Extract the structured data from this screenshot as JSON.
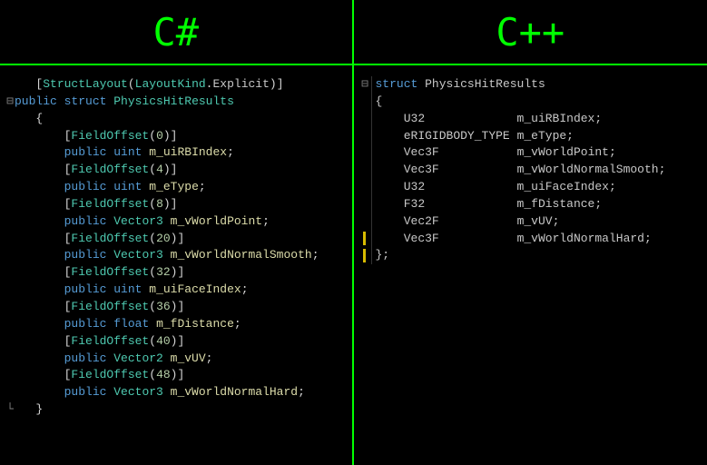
{
  "left": {
    "title": "C#",
    "attr_open": "[",
    "attr_close": "]",
    "struct_layout": "StructLayout",
    "layout_kind": "LayoutKind",
    "explicit": "Explicit",
    "public": "public",
    "struct": "struct",
    "struct_name": "PhysicsHitResults",
    "brace_open": "{",
    "brace_close": "}",
    "field_offset": "FieldOffset",
    "fields": [
      {
        "offset": "0",
        "type": "uint",
        "typecolor": "kw",
        "name": "m_uiRBIndex"
      },
      {
        "offset": "4",
        "type": "uint",
        "typecolor": "kw",
        "name": "m_eType"
      },
      {
        "offset": "8",
        "type": "Vector3",
        "typecolor": "ty",
        "name": "m_vWorldPoint"
      },
      {
        "offset": "20",
        "type": "Vector3",
        "typecolor": "ty",
        "name": "m_vWorldNormalSmooth"
      },
      {
        "offset": "32",
        "type": "uint",
        "typecolor": "kw",
        "name": "m_uiFaceIndex"
      },
      {
        "offset": "36",
        "type": "float",
        "typecolor": "kw",
        "name": "m_fDistance"
      },
      {
        "offset": "40",
        "type": "Vector2",
        "typecolor": "ty",
        "name": "m_vUV"
      },
      {
        "offset": "48",
        "type": "Vector3",
        "typecolor": "ty",
        "name": "m_vWorldNormalHard"
      }
    ]
  },
  "right": {
    "title": "C++",
    "struct_kw": "struct",
    "struct_name": "PhysicsHitResults",
    "brace_open": "{",
    "brace_close": "};",
    "fields": [
      {
        "type": "U32",
        "pad": "             ",
        "name": "m_uiRBIndex"
      },
      {
        "type": "eRIGIDBODY_TYPE",
        "pad": " ",
        "name": "m_eType"
      },
      {
        "type": "Vec3F",
        "pad": "           ",
        "name": "m_vWorldPoint"
      },
      {
        "type": "Vec3F",
        "pad": "           ",
        "name": "m_vWorldNormalSmooth"
      },
      {
        "type": "U32",
        "pad": "             ",
        "name": "m_uiFaceIndex"
      },
      {
        "type": "F32",
        "pad": "             ",
        "name": "m_fDistance"
      },
      {
        "type": "Vec2F",
        "pad": "           ",
        "name": "m_vUV"
      },
      {
        "type": "Vec3F",
        "pad": "           ",
        "name": "m_vWorldNormalHard"
      }
    ],
    "gutter_collapse": "⊟"
  }
}
